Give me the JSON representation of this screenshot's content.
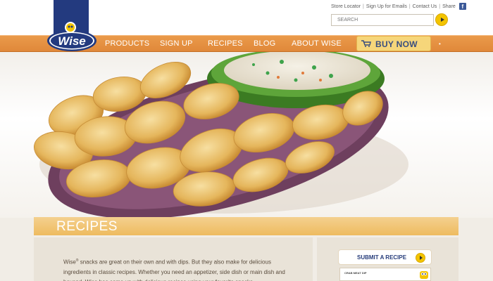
{
  "header": {
    "util_links": [
      "Store Locator",
      "Sign Up for Emails",
      "Contact Us",
      "Share"
    ],
    "search_placeholder": "SEARCH",
    "logo_text": "Wise"
  },
  "nav": {
    "items": [
      "PRODUCTS",
      "SIGN UP",
      "RECIPES",
      "BLOG",
      "ABOUT WISE"
    ],
    "buy_now": "BUY NOW"
  },
  "recipes": {
    "title": "RECIPES",
    "intro_1": "Wise",
    "intro_reg": "®",
    "intro_2": " snacks are great on their own and with dips. But they also make for delicious ingredients in classic recipes. Whether you need an appetizer, side dish or main dish and beyond, Wise has come up with delicious recipes using your favorite snacks."
  },
  "sidebar": {
    "submit_label": "SUBMIT A RECIPE",
    "card_title": "CRAB MEAT DIP"
  },
  "colors": {
    "nav_orange": "#e58f40",
    "brand_blue": "#233a7f",
    "band_gold": "#efc06a",
    "button_yellow": "#f3c400"
  }
}
